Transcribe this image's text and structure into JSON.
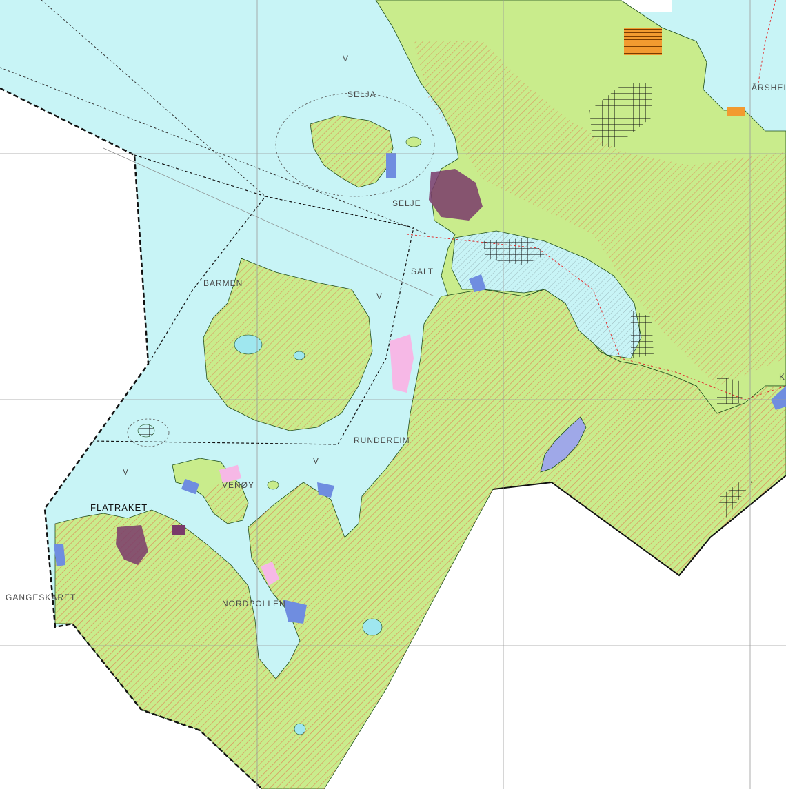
{
  "map": {
    "type": "zoning plan map",
    "colors": {
      "sea": "#c8f4f6",
      "land": "#c9ec8c",
      "hatch": "#e0704a",
      "boundary": "#111111",
      "grid": "#9a9a9a",
      "lake": "#9fe7ef",
      "pink_zone": "#f6b8e6",
      "blue_zone": "#6f8de0",
      "settlement": "#7a3a6a",
      "industry": "#f29a30"
    },
    "labels": {
      "selja": "SELJA",
      "selje": "SELJE",
      "salt": "SALT",
      "barmen": "BARMEN",
      "arsheim": "ÅRSHEIM",
      "k": "K",
      "rundereim": "RUNDEREIM",
      "venoy": "VENØY",
      "flatraket": "FLATRAKET",
      "gangeskaret": "GANGESKARET",
      "nordpollen": "NORDPOLLEN",
      "v1": "V",
      "v2": "V",
      "v3": "V",
      "v4": "V"
    }
  }
}
